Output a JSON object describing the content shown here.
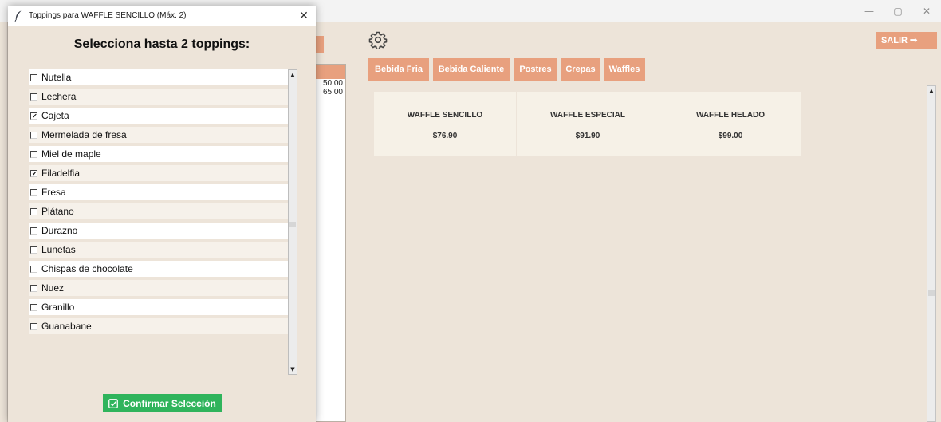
{
  "window": {
    "controls": {
      "minimize": "—",
      "maximize": "▢",
      "close": "✕"
    }
  },
  "main": {
    "salir_label": "SALIR ➡",
    "categories": [
      {
        "label": "Bebida Fria"
      },
      {
        "label": "Bebida Caliente"
      },
      {
        "label": "Postres"
      },
      {
        "label": "Crepas"
      },
      {
        "label": "Waffles"
      }
    ],
    "products": [
      {
        "name": "WAFFLE SENCILLO",
        "price": "$76.90"
      },
      {
        "name": "WAFFLE ESPECIAL",
        "price": "$91.90"
      },
      {
        "name": "WAFFLE HELADO",
        "price": "$99.00"
      }
    ],
    "order_prices": [
      "50.00",
      "65.00"
    ]
  },
  "dialog": {
    "title": "Toppings para WAFFLE SENCILLO (Máx. 2)",
    "close": "✕",
    "heading": "Selecciona hasta 2 toppings:",
    "toppings": [
      {
        "label": "Nutella",
        "checked": false
      },
      {
        "label": "Lechera",
        "checked": false
      },
      {
        "label": "Cajeta",
        "checked": true
      },
      {
        "label": "Mermelada de fresa",
        "checked": false
      },
      {
        "label": "Miel de maple",
        "checked": false
      },
      {
        "label": "Filadelfia",
        "checked": true
      },
      {
        "label": "Fresa",
        "checked": false
      },
      {
        "label": "Plátano",
        "checked": false
      },
      {
        "label": "Durazno",
        "checked": false
      },
      {
        "label": "Lunetas",
        "checked": false
      },
      {
        "label": "Chispas de chocolate",
        "checked": false
      },
      {
        "label": "Nuez",
        "checked": false
      },
      {
        "label": "Granillo",
        "checked": false
      },
      {
        "label": "Guanabane",
        "checked": false
      }
    ],
    "confirm_label": "Confirmar Selección"
  },
  "colors": {
    "accent": "#e8a07e",
    "confirm": "#2fb45c",
    "background": "#ede4d9",
    "card": "#f6f1e7"
  }
}
